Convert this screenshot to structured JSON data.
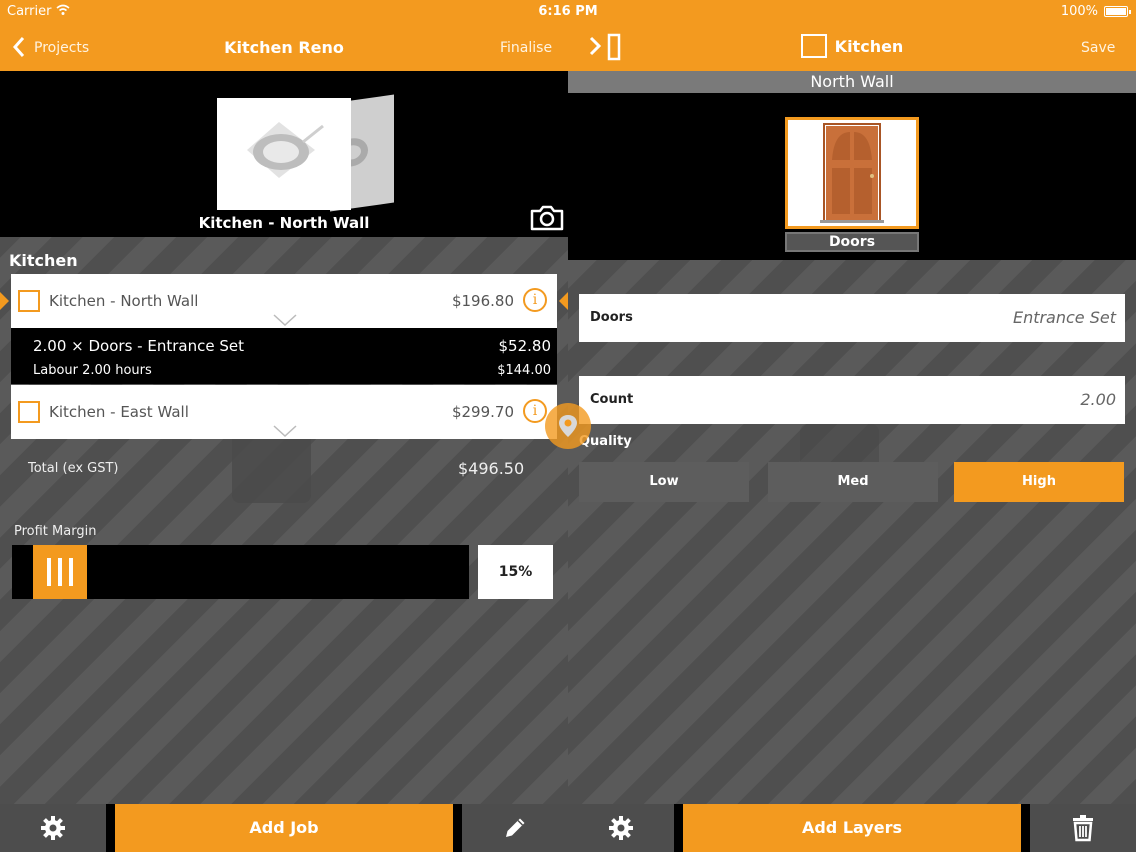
{
  "status_bar": {
    "carrier": "Carrier",
    "time": "6:16 PM",
    "battery": "100%"
  },
  "left_nav": {
    "back_label": "Projects",
    "title": "Kitchen Reno",
    "action_label": "Finalise"
  },
  "right_nav": {
    "title": "Kitchen",
    "action_label": "Save"
  },
  "left_panel": {
    "hero_label": "Kitchen - North Wall",
    "section_title": "Kitchen",
    "jobs": [
      {
        "name": "Kitchen - North Wall",
        "price": "$196.80"
      },
      {
        "name": "Kitchen - East Wall",
        "price": "$299.70"
      }
    ],
    "expanded": {
      "line1": "2.00 × Doors - Entrance Set",
      "line1_price": "$52.80",
      "line2": "Labour 2.00 hours",
      "line2_price": "$144.00"
    },
    "total_label": "Total (ex GST)",
    "total_value": "$496.50",
    "profit_margin_label": "Profit Margin",
    "profit_margin_value": "15%",
    "profit_margin_fraction": 0.15
  },
  "right_panel": {
    "wall_title": "North Wall",
    "layer_label": "Doors",
    "fields": [
      {
        "label": "Doors",
        "value": "Entrance Set"
      },
      {
        "label": "Count",
        "value": "2.00"
      }
    ],
    "quality_label": "Quality",
    "quality_options": [
      "Low",
      "Med",
      "High"
    ],
    "quality_selected": "High"
  },
  "toolbar": {
    "add_job_label": "Add Job",
    "add_layers_label": "Add Layers"
  },
  "colors": {
    "accent": "#f39a1f",
    "panel_dark": "#4d4d4d"
  },
  "icons": [
    "chevron-left-icon",
    "wifi-icon",
    "battery-icon",
    "sidebar-toggle-icon",
    "square-icon",
    "camera-icon",
    "info-icon",
    "chevron-down-icon",
    "map-pin-icon",
    "gear-icon",
    "pencil-icon",
    "trash-icon",
    "door-image"
  ]
}
